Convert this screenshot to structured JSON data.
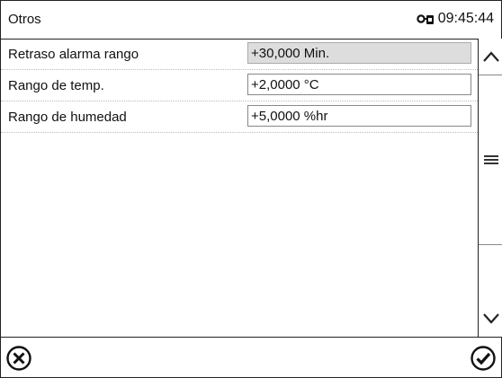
{
  "header": {
    "title": "Otros",
    "time": "09:45:44",
    "lock_icon": "key-lock-icon"
  },
  "rows": [
    {
      "label": "Retraso alarma rango",
      "value": "+30,000 Min.",
      "readonly": true
    },
    {
      "label": "Rango de temp.",
      "value": "+2,0000 °C",
      "readonly": false
    },
    {
      "label": "Rango de humedad",
      "value": "+5,0000 %hr",
      "readonly": false
    }
  ],
  "scrollbar": {
    "up_icon": "chevron-up-icon",
    "thumb_icon": "menu-lines-icon",
    "down_icon": "chevron-down-icon"
  },
  "footer": {
    "cancel_icon": "cancel-circle-icon",
    "confirm_icon": "confirm-check-circle-icon"
  }
}
